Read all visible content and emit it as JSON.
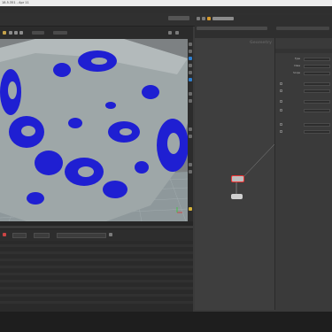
{
  "window": {
    "title": "18.5.351 - Apr 11"
  },
  "network": {
    "context_label": "Geometry",
    "nodes": [
      {
        "name": "",
        "sub": ""
      },
      {
        "name": "",
        "sub": ""
      }
    ]
  },
  "params": {
    "rows": [
      {
        "label": "Type",
        "value": ""
      },
      {
        "label": "Class",
        "value": ""
      },
      {
        "label": "Scope",
        "value": ""
      }
    ]
  },
  "colors": {
    "point_cloud": "#1f1fd2",
    "terrain": "#9aa4a6",
    "grid": "#a9b3b6",
    "accent": "#d79a2b",
    "node_selected": "#d0d0d0"
  },
  "icons": [
    "hand-icon",
    "rotate-icon",
    "pin-icon",
    "gear-icon",
    "camera-icon",
    "close-icon"
  ]
}
